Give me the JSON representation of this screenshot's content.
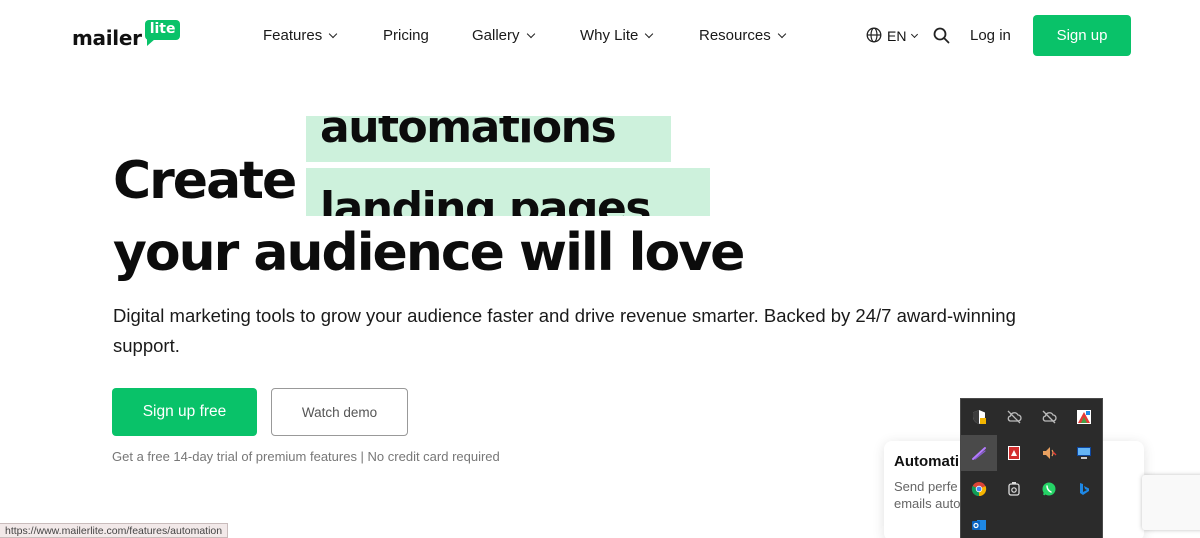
{
  "header": {
    "logo": {
      "word": "mailer",
      "badge": "lite"
    },
    "nav": [
      {
        "label": "Features",
        "dropdown": true
      },
      {
        "label": "Pricing",
        "dropdown": false
      },
      {
        "label": "Gallery",
        "dropdown": true
      },
      {
        "label": "Why Lite",
        "dropdown": true
      },
      {
        "label": "Resources",
        "dropdown": true
      }
    ],
    "language": "EN",
    "login_label": "Log in",
    "signup_label": "Sign up"
  },
  "hero": {
    "line1": "Create",
    "rotating_words": {
      "previous": "automations",
      "current": "landing pages"
    },
    "line2": "your audience will love",
    "subtext": "Digital marketing tools to grow your audience faster and drive revenue smarter. Backed by 24/7 award-winning support.",
    "cta_primary": "Sign up free",
    "cta_secondary": "Watch demo",
    "trial_note": "Get a free 14-day trial of premium features | No credit card required"
  },
  "automation_card": {
    "title": "Automati",
    "desc": "Send perfe emails auto"
  },
  "tray_icons": [
    "security-shield-icon",
    "cloud-offline-icon",
    "cloud-offline-icon",
    "color-picker-icon",
    "pen-icon",
    "pdf-icon",
    "volume-icon",
    "display-icon",
    "chrome-icon",
    "camera-icon",
    "whatsapp-icon",
    "bing-icon",
    "outlook-icon"
  ],
  "status_bar": {
    "url": "https://www.mailerlite.com/features/automation"
  },
  "colors": {
    "brand_green": "#09c269",
    "highlight_green": "#cdf1dc",
    "tray_bg": "#2b2b2b"
  }
}
